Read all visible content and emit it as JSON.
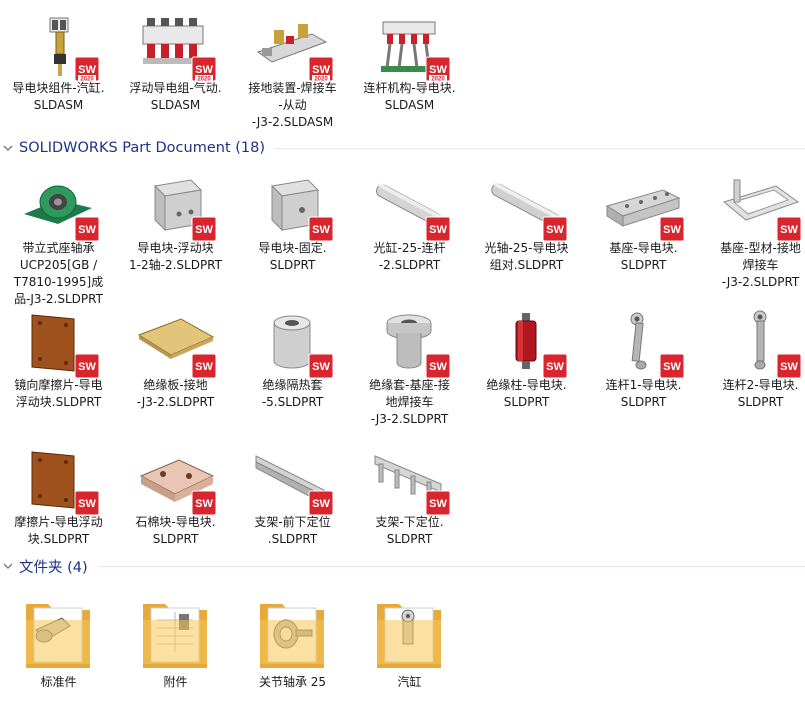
{
  "assemblies": [
    {
      "name": "导电块组件-汽缸.SLDASM",
      "lines": [
        "导电块组件-汽缸.",
        "SLDASM"
      ],
      "icon": "conductive-block-cylinder-assembly-icon"
    },
    {
      "name": "浮动导电组-气动.SLDASM",
      "lines": [
        "浮动导电组-气动.",
        "SLDASM"
      ],
      "icon": "floating-conductor-pneumatic-assembly-icon"
    },
    {
      "name": "接地装置-焊接车-从动-J3-2.SLDASM",
      "lines": [
        "接地装置-焊接车",
        "-从动",
        "-J3-2.SLDASM"
      ],
      "icon": "grounding-device-assembly-icon"
    },
    {
      "name": "连杆机构-导电块.SLDASM",
      "lines": [
        "连杆机构-导电块.",
        "SLDASM"
      ],
      "icon": "linkage-mechanism-assembly-icon"
    }
  ],
  "part_group": {
    "title": "SOLIDWORKS Part Document (18)"
  },
  "parts": [
    {
      "lines": [
        "带立式座轴承",
        "UCP205[GB /",
        "T7810-1995]成",
        "品-J3-2.SLDPRT"
      ],
      "icon": "pillow-block-bearing-icon"
    },
    {
      "lines": [
        "导电块-浮动块",
        "1-2轴-2.SLDPRT"
      ],
      "icon": "gray-block-icon"
    },
    {
      "lines": [
        "导电块-固定.",
        "SLDPRT"
      ],
      "icon": "gray-block-hole-icon"
    },
    {
      "lines": [
        "光缸-25-连杆",
        "-2.SLDPRT"
      ],
      "icon": "rod-icon"
    },
    {
      "lines": [
        "光轴-25-导电块",
        "组对.SLDPRT"
      ],
      "icon": "shaft-icon"
    },
    {
      "lines": [
        "基座-导电块.",
        "SLDPRT"
      ],
      "icon": "base-bar-icon"
    },
    {
      "lines": [
        "基座-型材-接地",
        "焊接车",
        "-J3-2.SLDPRT"
      ],
      "icon": "profile-frame-icon"
    },
    {
      "lines": [
        "镜向摩擦片-导电",
        "浮动块.SLDPRT"
      ],
      "icon": "brown-plate-icon"
    },
    {
      "lines": [
        "绝缘板-接地",
        "-J3-2.SLDPRT"
      ],
      "icon": "yellow-board-icon"
    },
    {
      "lines": [
        "绝缘隔热套",
        "-5.SLDPRT"
      ],
      "icon": "sleeve-icon"
    },
    {
      "lines": [
        "绝缘套-基座-接",
        "地焊接车",
        "-J3-2.SLDPRT"
      ],
      "icon": "flanged-sleeve-icon"
    },
    {
      "lines": [
        "绝缘柱-导电块.",
        "SLDPRT"
      ],
      "icon": "red-pillar-icon"
    },
    {
      "lines": [
        "连杆1-导电块.",
        "SLDPRT"
      ],
      "icon": "connecting-rod-icon"
    },
    {
      "lines": [
        "连杆2-导电块.",
        "SLDPRT"
      ],
      "icon": "connecting-rod-2-icon"
    },
    {
      "lines": [
        "摩擦片-导电浮动",
        "块.SLDPRT"
      ],
      "icon": "brown-plate-icon"
    },
    {
      "lines": [
        "石棉块-导电块.",
        "SLDPRT"
      ],
      "icon": "asbestos-block-icon"
    },
    {
      "lines": [
        "支架-前下定位",
        ".SLDPRT"
      ],
      "icon": "bracket-front-icon"
    },
    {
      "lines": [
        "支架-下定位.",
        "SLDPRT"
      ],
      "icon": "bracket-lower-icon"
    }
  ],
  "folder_group": {
    "title": "文件夹 (4)"
  },
  "folders": [
    {
      "label": "标准件",
      "icon": "folder-standard-parts-icon"
    },
    {
      "label": "附件",
      "icon": "folder-attachments-icon"
    },
    {
      "label": "关节轴承 25",
      "icon": "folder-joint-bearing-icon"
    },
    {
      "label": "汽缸",
      "icon": "folder-cylinder-icon"
    }
  ],
  "badge": {
    "text": "SW",
    "year": "2020"
  },
  "colors": {
    "accent": "#1e3287",
    "sw_red": "#d9262e",
    "folder": "#f4c14d"
  }
}
